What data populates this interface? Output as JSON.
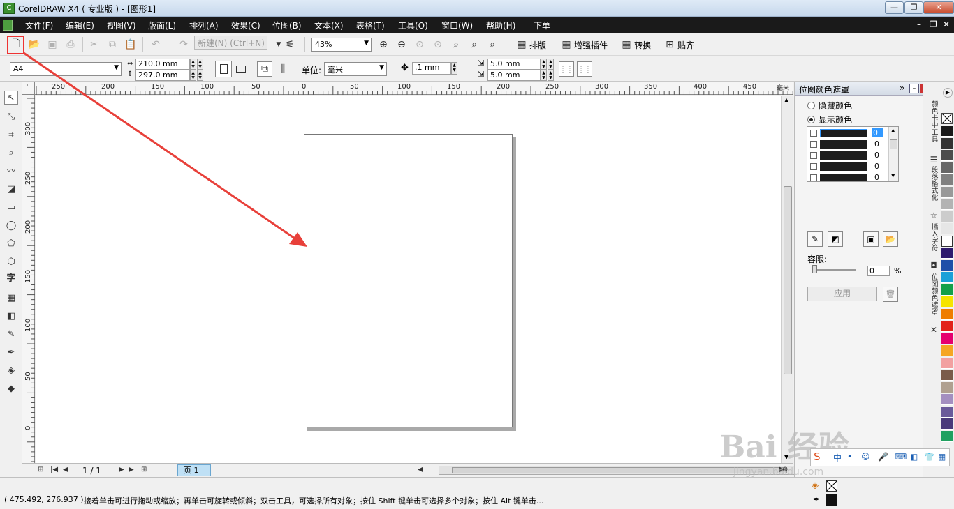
{
  "window": {
    "title": "CorelDRAW X4 ( 专业版 ) - [图形1]",
    "app_icon": "coreldraw-icon",
    "controls": [
      "minimize",
      "restore",
      "close"
    ]
  },
  "menu": {
    "items": [
      "文件(F)",
      "编辑(E)",
      "视图(V)",
      "版面(L)",
      "排列(A)",
      "效果(C)",
      "位图(B)",
      "文本(X)",
      "表格(T)",
      "工具(O)",
      "窗口(W)",
      "帮助(H)",
      "下单"
    ]
  },
  "toolbar": {
    "new_tooltip": "新建(N) (Ctrl+N)",
    "zoom": "43%",
    "buttons": [
      "排版",
      "增强插件",
      "转换",
      "贴齐"
    ]
  },
  "property_bar": {
    "paper_size": "A4",
    "width": "210.0 mm",
    "height": "297.0 mm",
    "unit_label": "单位:",
    "unit": "毫米",
    "nudge": ".1 mm",
    "dup_x": "5.0 mm",
    "dup_y": "5.0 mm"
  },
  "rulers": {
    "unit": "毫米",
    "h_ticks": [
      "250",
      "200",
      "150",
      "100",
      "50",
      "0",
      "50",
      "100",
      "150",
      "200",
      "250",
      "300",
      "350",
      "400",
      "450"
    ],
    "v_ticks": [
      "300",
      "250",
      "200",
      "150",
      "100",
      "50",
      "0"
    ]
  },
  "page_nav": {
    "counter": "1 / 1",
    "tab": "页 1"
  },
  "docker": {
    "title": "位图颜色遮罩",
    "radio_hide": "隐藏颜色",
    "radio_show": "显示颜色",
    "rows": [
      "0",
      "0",
      "0",
      "0",
      "0"
    ],
    "tolerance_label": "容限:",
    "tolerance_value": "0",
    "percent": "%",
    "apply": "应用"
  },
  "docker_tabs": [
    "颜色卡中工具",
    "段落格式化",
    "插入字符",
    "位图颜色遮罩"
  ],
  "palette": [
    "#1a1a1a",
    "#333333",
    "#4d4d4d",
    "#666666",
    "#808080",
    "#999999",
    "#b3b3b3",
    "#cccccc",
    "#e6e6e6",
    "#ffffff",
    "#2e1a6e",
    "#1f4fa8",
    "#1aa0d8",
    "#14a04a",
    "#f6e400",
    "#ef7d00",
    "#e2231a",
    "#e6006e",
    "#f5a623",
    "#f2a0a0",
    "#7a5c4a",
    "#b0a090",
    "#a48fc0",
    "#6a5a9a",
    "#4a3a7a",
    "#20a060"
  ],
  "status": {
    "coords": "( 475.492, 276.937 )",
    "hint": "接着单击可进行拖动或缩放；再单击可旋转或倾斜；双击工具，可选择所有对象；按住 Shift 键单击可选择多个对象；按住 Alt 键单击..."
  },
  "watermark": {
    "brand": "Bai  经验",
    "url": "jingyan.baidu.com"
  }
}
